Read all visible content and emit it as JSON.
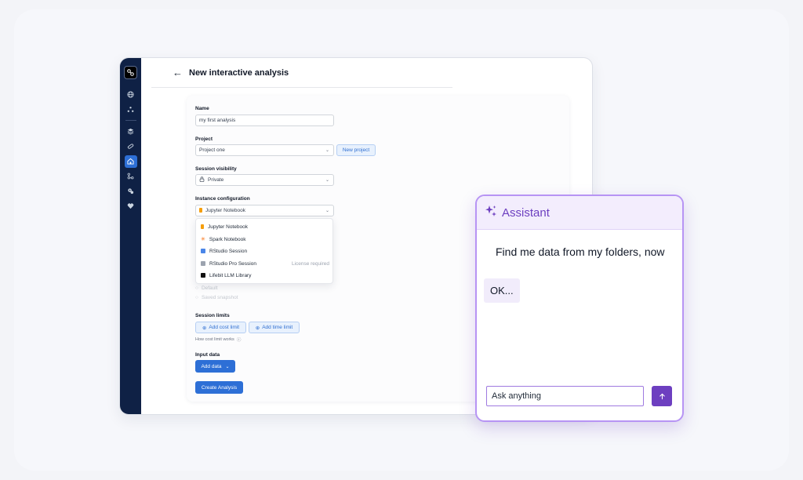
{
  "header": {
    "back_icon": "arrow-left-icon",
    "title": "New interactive analysis"
  },
  "sidebar": {
    "items": [
      {
        "icon": "globe-icon"
      },
      {
        "icon": "nodes-icon"
      },
      {
        "icon": "layers-icon"
      },
      {
        "icon": "pill-icon"
      },
      {
        "icon": "workspace-icon",
        "active": true
      },
      {
        "icon": "workflow-icon"
      },
      {
        "icon": "gears-icon"
      },
      {
        "icon": "heart-icon"
      }
    ]
  },
  "form": {
    "name_label": "Name",
    "name_value": "my first analysis",
    "project_label": "Project",
    "project_value": "Project one",
    "new_project_label": "New project",
    "visibility_label": "Session visibility",
    "visibility_value": "Private",
    "instance_label": "Instance configuration",
    "instance_value": "Jupyter Notebook",
    "dropdown_options": [
      {
        "label": "Jupyter Notebook",
        "icon": "jupyter-icon",
        "tag": ""
      },
      {
        "label": "Spark Notebook",
        "icon": "spark-icon",
        "tag": ""
      },
      {
        "label": "RStudio Session",
        "icon": "rstudio-icon",
        "tag": ""
      },
      {
        "label": "RStudio Pro Session",
        "icon": "rstudio-pro-icon",
        "tag": "License required"
      },
      {
        "label": "Lifebit LLM Library",
        "icon": "lifebit-icon",
        "tag": ""
      }
    ],
    "radio_default": "Default",
    "radio_saved": "Saved snapshot",
    "limits_label": "Session limits",
    "add_cost_limit": "Add cost limit",
    "add_time_limit": "Add time limit",
    "cost_hint": "How cost limit works",
    "input_data_label": "Input data",
    "add_data": "Add data",
    "create_analysis": "Create Analysis"
  },
  "assistant": {
    "title": "Assistant",
    "user_message": "Find me data from my folders, now",
    "bot_message": "OK...",
    "input_value": "Ask anything"
  },
  "colors": {
    "sidebar": "#0f2145",
    "primary": "#2d6fd6",
    "assistant_accent": "#6d3fc0"
  }
}
